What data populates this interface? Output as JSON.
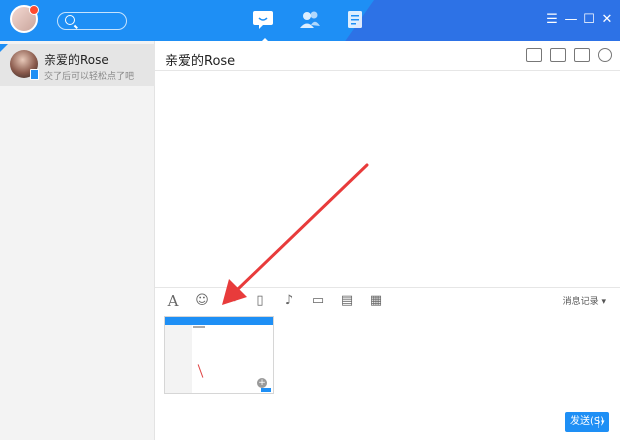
{
  "window": {
    "controls": [
      "☰",
      "—",
      "☐",
      "✕"
    ]
  },
  "nav": {
    "tabs": [
      "chat",
      "contacts",
      "files"
    ],
    "active": "chat"
  },
  "sidebar": {
    "chats": [
      {
        "name": "亲爱的Rose",
        "preview": "交了后可以轻松点了吧"
      }
    ]
  },
  "chat": {
    "title": "亲爱的Rose",
    "toolbar_icons": [
      "font-icon",
      "emoji-icon",
      "screenshot-icon",
      "shake-icon",
      "voice-icon",
      "image-icon",
      "folder-icon",
      "calendar-icon"
    ],
    "history_label": "消息记录 ▾",
    "send_label": "发送(S)",
    "send_caret": "▾"
  },
  "colors": {
    "accent": "#1e8ff5",
    "arrow": "#e83b3b"
  }
}
